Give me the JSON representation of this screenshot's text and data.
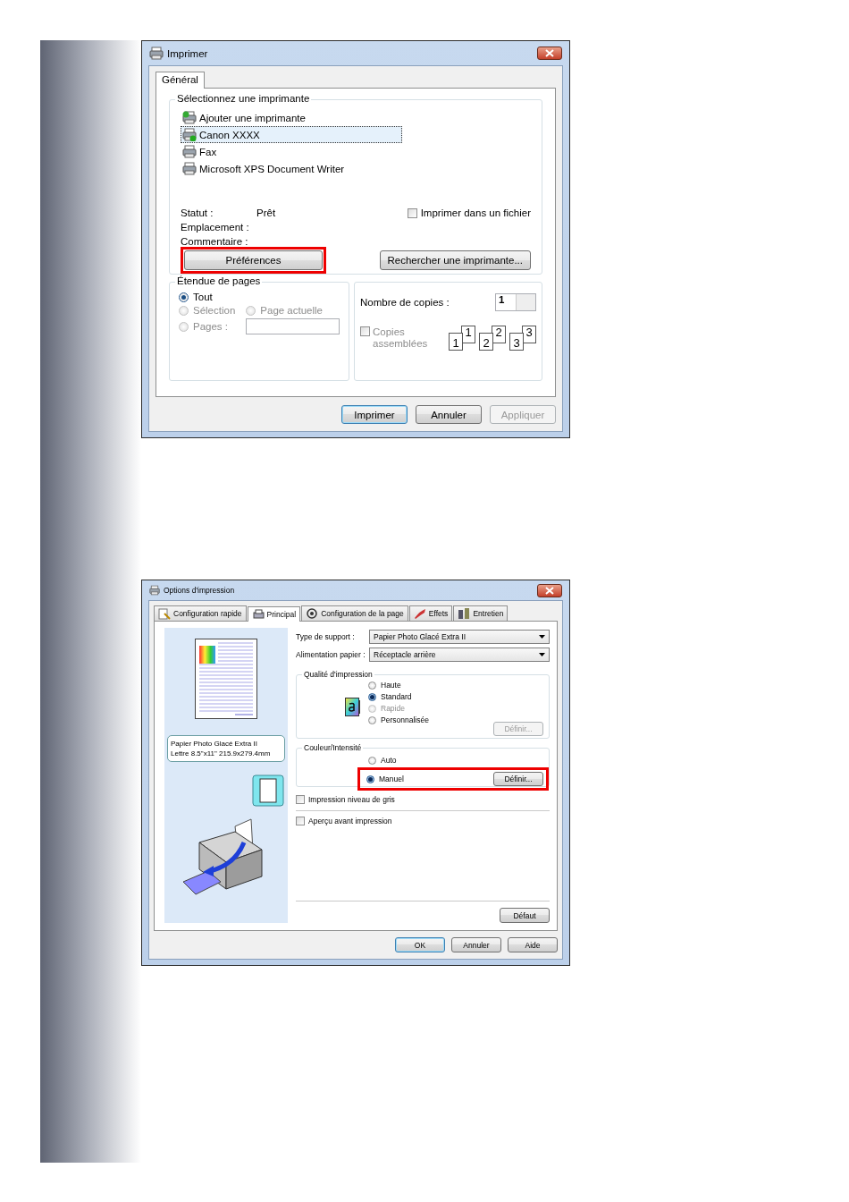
{
  "print_dialog": {
    "title": "Imprimer",
    "tabs": [
      {
        "label": "Général",
        "selected": true
      }
    ],
    "printer_group": {
      "legend": "Sélectionnez une imprimante",
      "printers": [
        {
          "name": "Ajouter une imprimante",
          "kind": "add",
          "selected": false
        },
        {
          "name": "Canon XXXX",
          "kind": "default",
          "selected": true
        },
        {
          "name": "Fax",
          "kind": "printer",
          "selected": false
        },
        {
          "name": "Microsoft XPS Document Writer",
          "kind": "printer",
          "selected": false
        }
      ],
      "info": [
        {
          "label": "Statut :",
          "value": "Prêt"
        },
        {
          "label": "Emplacement :"
        },
        {
          "label": "Commentaire :"
        }
      ],
      "print_to_file": {
        "label": "Imprimer dans un fichier",
        "checked": false
      },
      "preferences_button": {
        "label": "Préférences",
        "highlighted": true
      },
      "find_button": {
        "label": "Rechercher une imprimante..."
      }
    },
    "page_range": {
      "legend": "Étendue de pages",
      "options": [
        {
          "label": "Tout",
          "selected": true,
          "disabled": false
        },
        {
          "label": "Sélection",
          "selected": false,
          "disabled": true
        },
        {
          "label": "Page actuelle",
          "selected": false,
          "disabled": true
        },
        {
          "label": "Pages :",
          "selected": false,
          "disabled": true
        }
      ]
    },
    "copies": {
      "label": "Nombre de copies :",
      "value": "1",
      "collate": {
        "label": "Copies assemblées",
        "checked": false,
        "disabled": true
      },
      "collate_sets": [
        {
          "front": "1",
          "back": "1"
        },
        {
          "front": "2",
          "back": "2"
        },
        {
          "front": "3",
          "back": "3"
        }
      ]
    },
    "buttons": [
      {
        "label": "Imprimer",
        "default": true,
        "disabled": false
      },
      {
        "label": "Annuler",
        "default": false,
        "disabled": false
      },
      {
        "label": "Appliquer",
        "default": false,
        "disabled": true
      }
    ]
  },
  "options_dialog": {
    "title": "Options d'impression",
    "tabs": [
      {
        "label": "Configuration rapide",
        "selected": false,
        "kind": "quick"
      },
      {
        "label": "Principal",
        "selected": true,
        "kind": "main"
      },
      {
        "label": "Configuration de la page",
        "selected": false,
        "kind": "page"
      },
      {
        "label": "Effets",
        "selected": false,
        "kind": "effects"
      },
      {
        "label": "Entretien",
        "selected": false,
        "kind": "maintenance"
      }
    ],
    "media_info": [
      "Papier Photo Glacé Extra II",
      "Lettre 8.5\"x11\" 215.9x279.4mm"
    ],
    "dropdowns": [
      {
        "label": "Type de support :",
        "value": "Papier Photo Glacé Extra II"
      },
      {
        "label": "Alimentation papier :",
        "value": "Réceptacle arrière"
      }
    ],
    "quality": {
      "legend": "Qualité d'impression",
      "options": [
        {
          "label": "Haute",
          "selected": false,
          "disabled": false
        },
        {
          "label": "Standard",
          "selected": true,
          "disabled": false
        },
        {
          "label": "Rapide",
          "selected": false,
          "disabled": true
        },
        {
          "label": "Personnalisée",
          "selected": false,
          "disabled": false
        }
      ],
      "define_button": {
        "label": "Définir...",
        "disabled": true
      }
    },
    "color": {
      "legend": "Couleur/Intensité",
      "options": [
        {
          "label": "Auto",
          "selected": false,
          "disabled": false
        },
        {
          "label": "Manuel",
          "selected": true,
          "disabled": false
        }
      ],
      "define_button": {
        "label": "Définir...",
        "disabled": false
      },
      "highlighted": true
    },
    "checkboxes": [
      {
        "label": "Impression niveau de gris",
        "checked": false
      },
      {
        "label": "Aperçu avant impression",
        "checked": false
      }
    ],
    "default_button": {
      "label": "Défaut"
    },
    "buttons": [
      {
        "label": "OK",
        "default": true
      },
      {
        "label": "Annuler",
        "default": false
      },
      {
        "label": "Aide",
        "default": false
      }
    ]
  }
}
